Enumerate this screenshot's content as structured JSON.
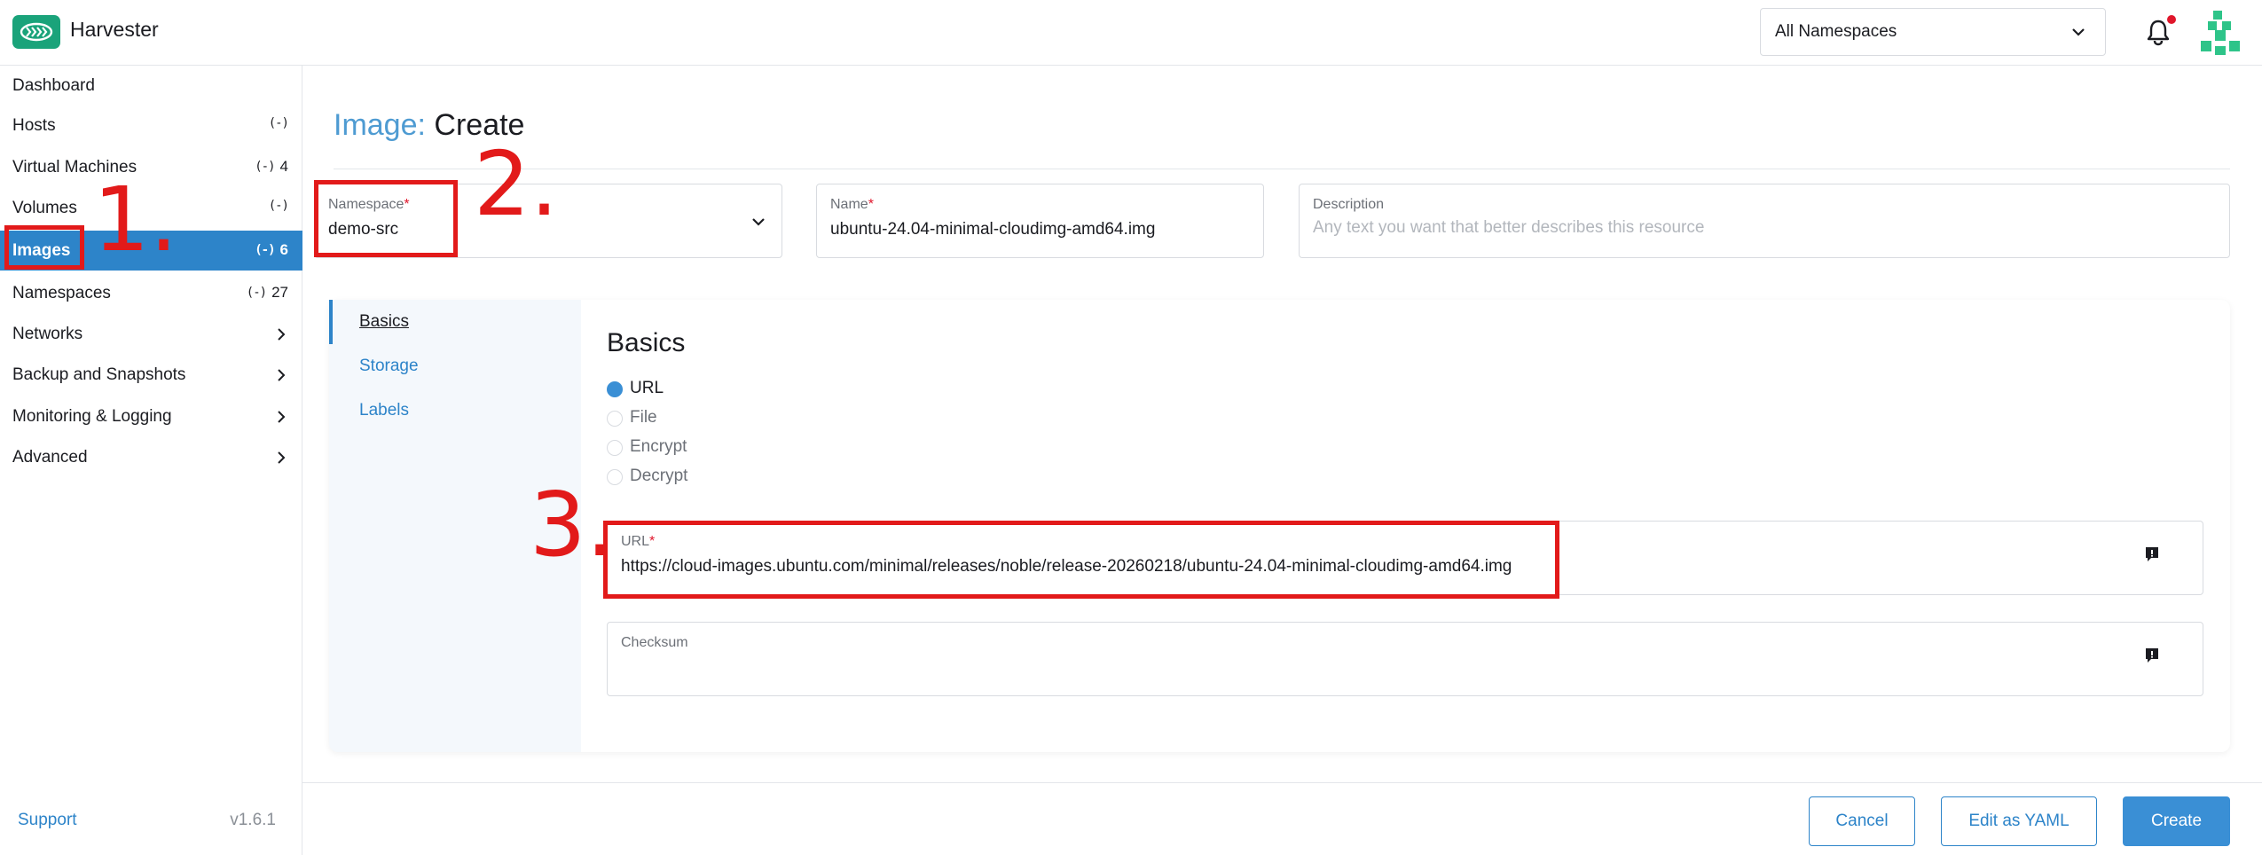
{
  "header": {
    "app_name": "Harvester",
    "namespace_selector": "All Namespaces",
    "icons": [
      "harvester-logo-icon",
      "chevron-down-icon",
      "bell-icon",
      "avatar-icon"
    ]
  },
  "sidebar": {
    "items": [
      {
        "label": "Dashboard",
        "count": "",
        "has_icon": false,
        "chevron": false
      },
      {
        "label": "Hosts",
        "count": "",
        "has_icon": true,
        "chevron": false
      },
      {
        "label": "Virtual Machines",
        "count": "4",
        "has_icon": true,
        "chevron": false
      },
      {
        "label": "Volumes",
        "count": "",
        "has_icon": true,
        "chevron": false
      },
      {
        "label": "Images",
        "count": "6",
        "has_icon": true,
        "chevron": false,
        "active": true
      },
      {
        "label": "Namespaces",
        "count": "27",
        "has_icon": true,
        "chevron": false
      },
      {
        "label": "Networks",
        "count": "",
        "has_icon": false,
        "chevron": true
      },
      {
        "label": "Backup and Snapshots",
        "count": "",
        "has_icon": false,
        "chevron": true
      },
      {
        "label": "Monitoring & Logging",
        "count": "",
        "has_icon": false,
        "chevron": true
      },
      {
        "label": "Advanced",
        "count": "",
        "has_icon": false,
        "chevron": true
      }
    ],
    "resource_icon": "(-)",
    "support": "Support",
    "version": "v1.6.1"
  },
  "page": {
    "title_prefix": "Image:",
    "title_rest": "Create",
    "namespace": {
      "label": "Namespace",
      "required": "*",
      "value": "demo-src"
    },
    "name": {
      "label": "Name",
      "required": "*",
      "value": "ubuntu-24.04-minimal-cloudimg-amd64.img"
    },
    "description": {
      "label": "Description",
      "placeholder": "Any text you want that better describes this resource"
    }
  },
  "tabs": [
    {
      "label": "Basics",
      "active": true
    },
    {
      "label": "Storage",
      "active": false
    },
    {
      "label": "Labels",
      "active": false
    }
  ],
  "basics": {
    "title": "Basics",
    "source_options": [
      {
        "label": "URL",
        "checked": true
      },
      {
        "label": "File",
        "checked": false
      },
      {
        "label": "Encrypt",
        "checked": false
      },
      {
        "label": "Decrypt",
        "checked": false
      }
    ],
    "url": {
      "label": "URL",
      "required": "*",
      "value": "https://cloud-images.ubuntu.com/minimal/releases/noble/release-20260218/ubuntu-24.04-minimal-cloudimg-amd64.img"
    },
    "checksum": {
      "label": "Checksum",
      "value": ""
    }
  },
  "annotations": {
    "step1": "1.",
    "step2": "2.",
    "step3": "3.",
    "color": "#e21a1a"
  },
  "footer": {
    "cancel": "Cancel",
    "edit_yaml": "Edit as YAML",
    "create": "Create"
  },
  "colors": {
    "accent": "#2d84c9",
    "brand": "#1aa37a",
    "active_bg": "#2d84c9"
  }
}
